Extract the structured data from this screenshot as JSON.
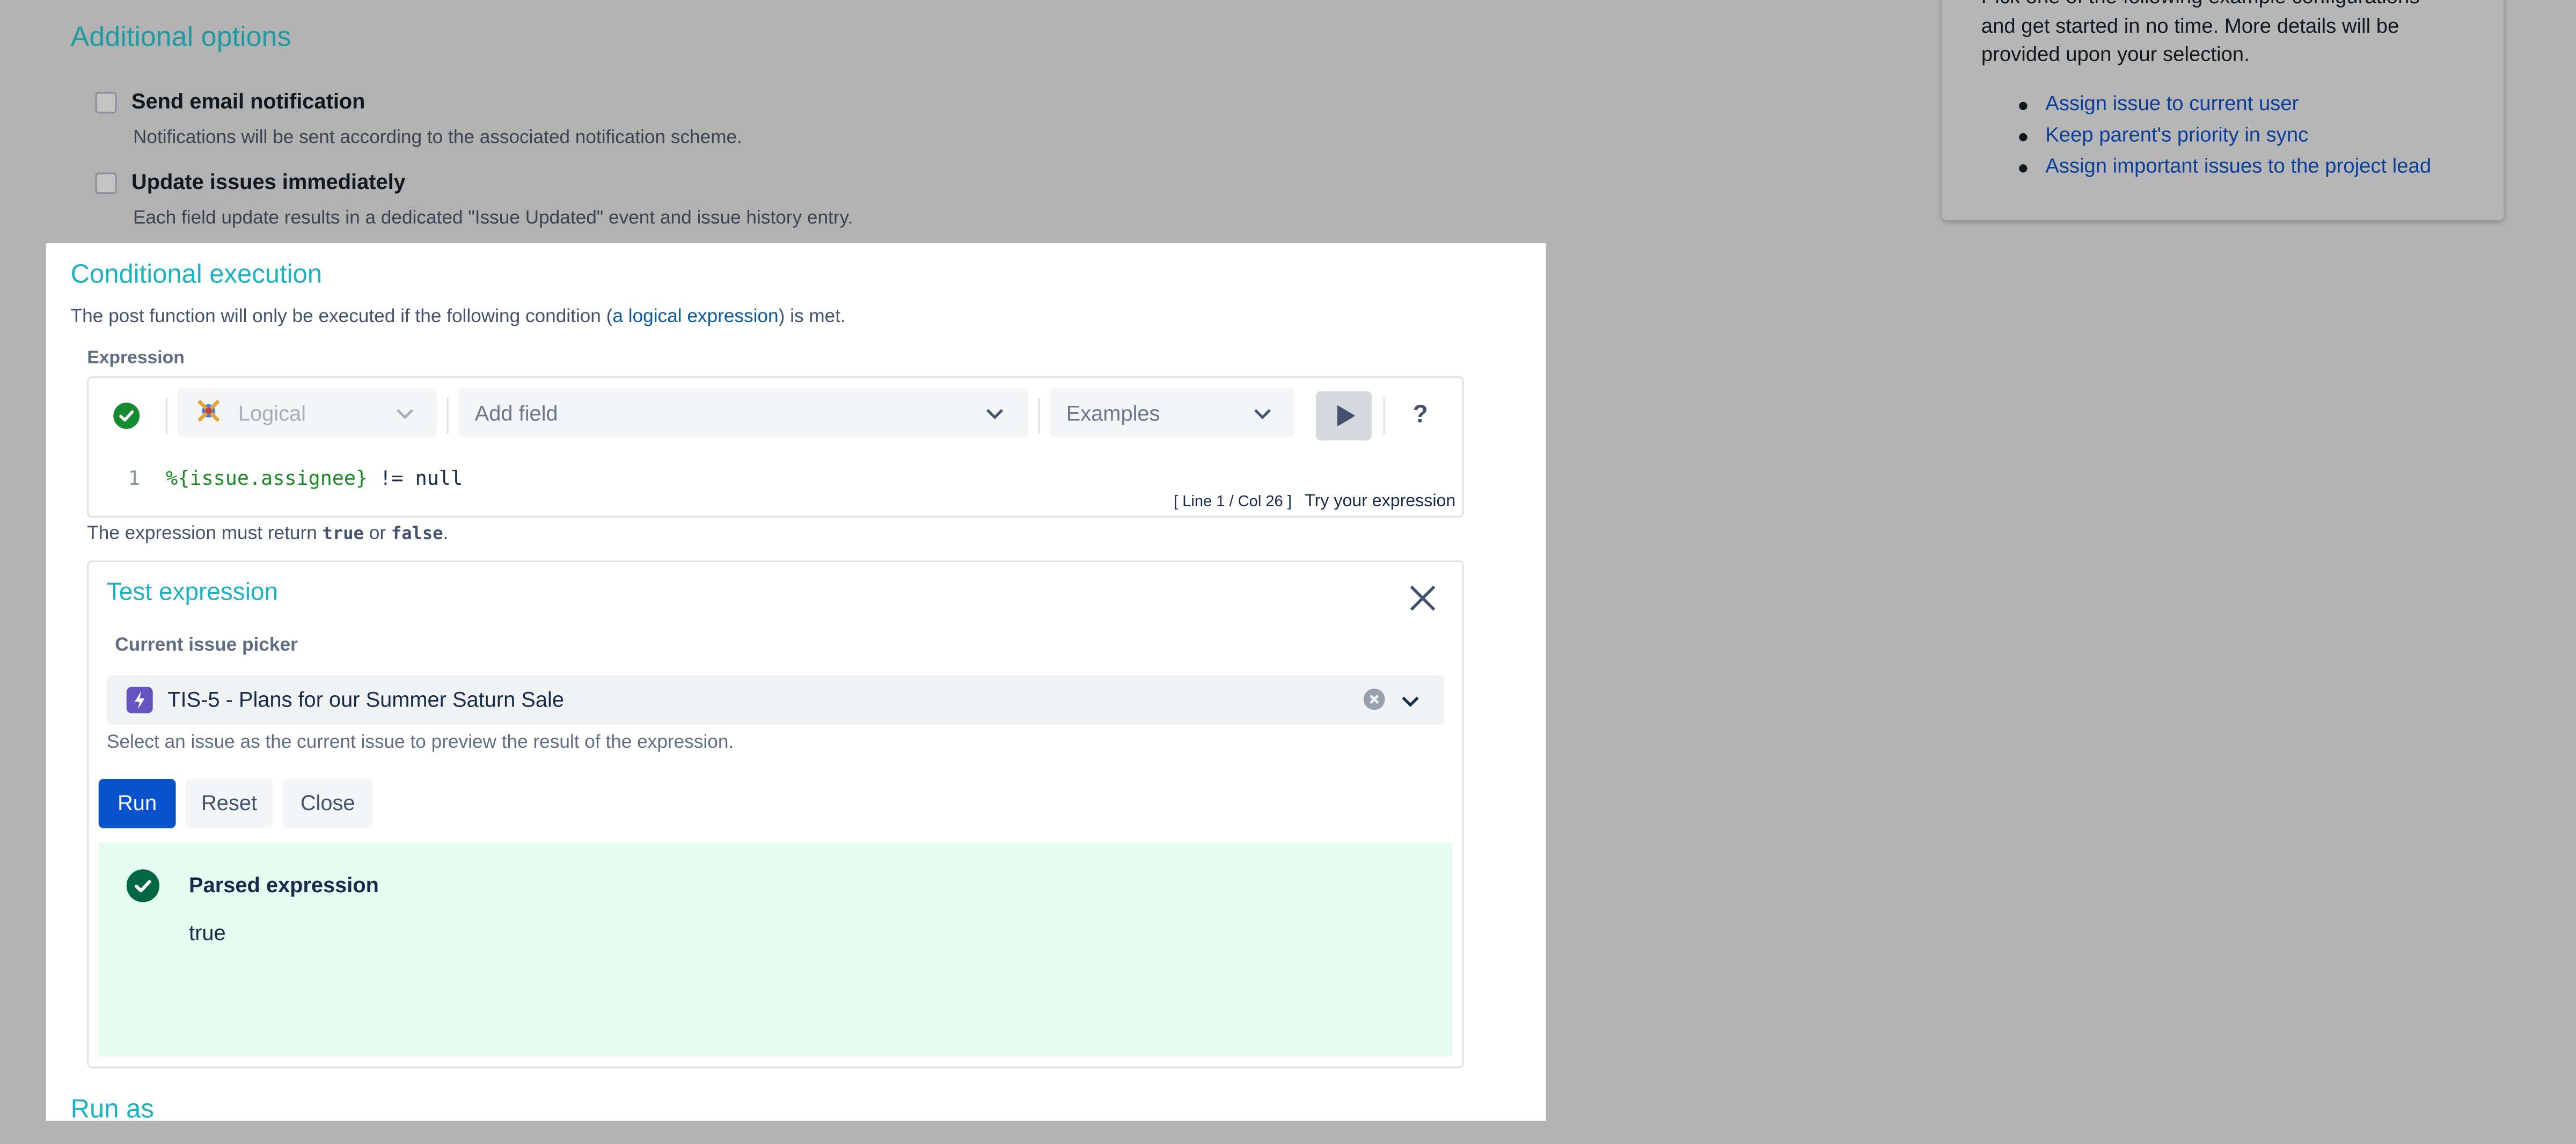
{
  "background": {
    "additional_options_heading": "Additional options",
    "options": [
      {
        "label": "Send email notification",
        "description": "Notifications will be sent according to the associated notification scheme."
      },
      {
        "label": "Update issues immediately",
        "description": "Each field update results in a dedicated \"Issue Updated\" event and issue history entry."
      }
    ],
    "side_panel": {
      "intro_line1": "Pick one of the following example configurations",
      "intro_line2": "and get started in no time. More details will be",
      "intro_line3": "provided upon your selection.",
      "links": [
        "Assign issue to current user",
        "Keep parent's priority in sync",
        "Assign important issues to the project lead"
      ]
    }
  },
  "modal": {
    "heading": "Conditional execution",
    "description_prefix": "The post function will only be executed if the following condition (",
    "description_link": "a logical expression",
    "description_suffix": ") is met.",
    "expression_label": "Expression",
    "toolbar": {
      "type_select": "Logical",
      "add_field_select": "Add field",
      "examples_select": "Examples",
      "help": "?"
    },
    "code": {
      "line_number": "1",
      "field": "%{issue.assignee}",
      "rest": " != null"
    },
    "status": "[ Line 1 / Col 26 ]",
    "try_link": "Try your expression",
    "must_return_prefix": "The expression must return ",
    "must_return_true": "true",
    "must_return_or": " or ",
    "must_return_false": "false",
    "must_return_suffix": ".",
    "test": {
      "title": "Test expression",
      "picker_label": "Current issue picker",
      "picker_value": "TIS-5 - Plans for our Summer Saturn Sale",
      "picker_help": "Select an issue as the current issue to preview the result of the expression.",
      "run_label": "Run",
      "reset_label": "Reset",
      "close_label": "Close",
      "result_title": "Parsed expression",
      "result_value": "true"
    },
    "run_as_heading": "Run as"
  },
  "colors": {
    "accent": "#1cb2c2",
    "primary_button": "#0852cc",
    "success": "#006644",
    "result_bg": "#e3fcef",
    "overlay": "#b2b2b2"
  },
  "icons": [
    "checkbox-icon",
    "success-check-icon",
    "logical-type-icon",
    "chevron-down-icon",
    "play-icon",
    "help-icon",
    "close-icon",
    "issue-type-icon",
    "clear-icon"
  ]
}
